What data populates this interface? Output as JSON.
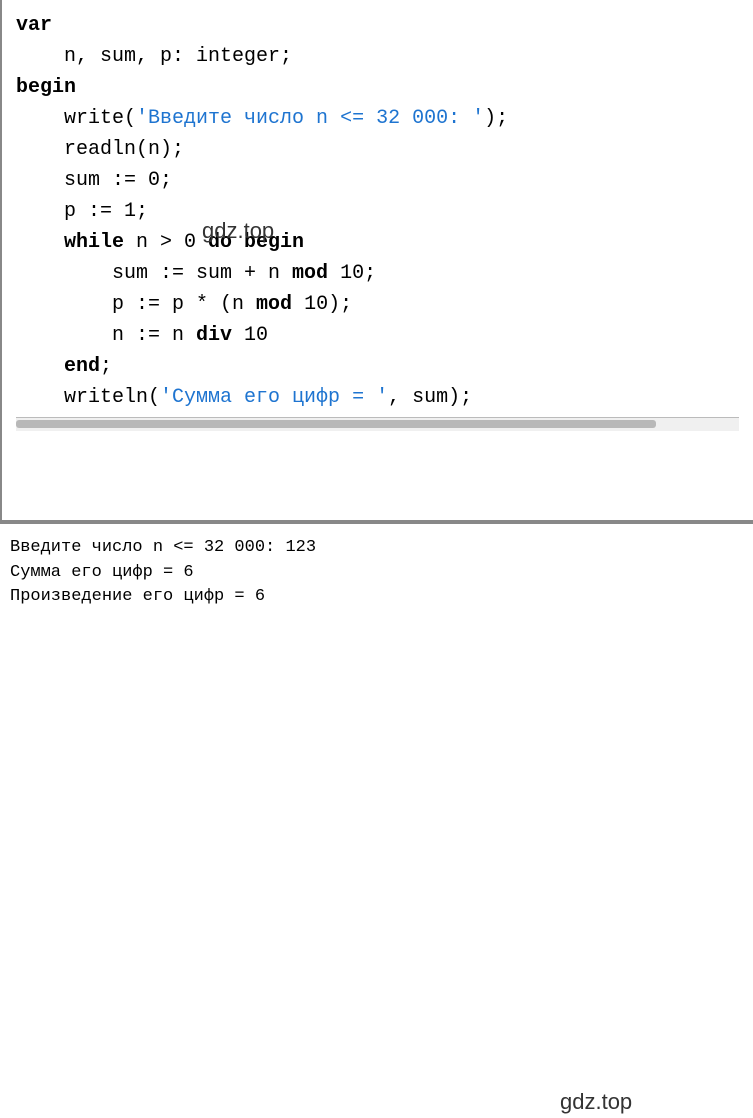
{
  "code": {
    "l1_kw": "var",
    "l2": "    n, sum, p: integer;",
    "l3_kw": "begin",
    "l4_a": "    write(",
    "l4_str": "'Введите число n <= 32 000: '",
    "l4_b": ");",
    "l5": "    readln(n);",
    "l6": "    sum := 0;",
    "l7": "    p := 1;",
    "l8_a": "    ",
    "l8_kw": "while",
    "l8_b": " n > 0 ",
    "l8_kw2": "do begin",
    "l9_a": "        sum := sum + n ",
    "l9_kw": "mod",
    "l9_b": " 10;",
    "l10_a": "        p := p * (n ",
    "l10_kw": "mod",
    "l10_b": " 10);",
    "l11_a": "        n := n ",
    "l11_kw": "div",
    "l11_b": " 10",
    "l12_a": "    ",
    "l12_kw": "end",
    "l12_b": ";",
    "l13_a": "    writeln(",
    "l13_str": "'Сумма его цифр = '",
    "l13_b": ", sum);"
  },
  "output": {
    "l1": "Введите число n <= 32 000: 123",
    "l2": "Сумма его цифр = 6",
    "l3": "Произведение его цифр = 6"
  },
  "watermark": {
    "text1": "gdz.top",
    "text2": "gdz.top"
  }
}
